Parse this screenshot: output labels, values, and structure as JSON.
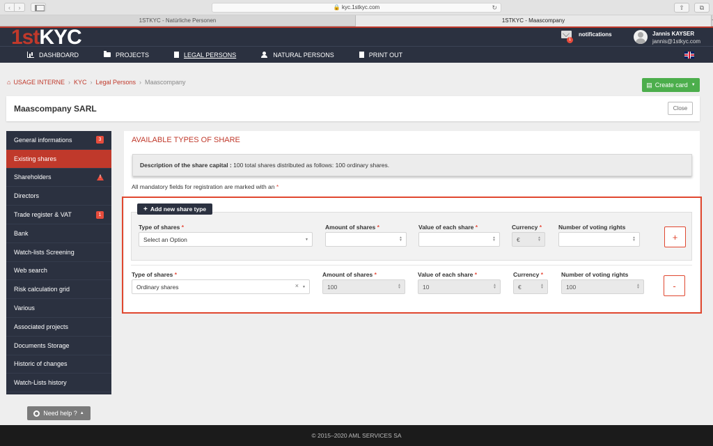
{
  "browser": {
    "url": "kyc.1stkyc.com",
    "tabs": [
      "1STKYC - Natürliche Personen",
      "1STKYC - Maascompany"
    ],
    "new_tab": "+"
  },
  "header": {
    "logo_part1": "1st",
    "logo_part2": "KYC",
    "notifications_label": "notifications",
    "notifications_count": "1",
    "user_name": "Jannis KAYSER",
    "user_email": "jannis@1stkyc.com"
  },
  "nav": {
    "items": [
      "DASHBOARD",
      "PROJECTS",
      "LEGAL PERSONS",
      "NATURAL PERSONS",
      "PRINT OUT"
    ]
  },
  "breadcrumb": {
    "items": [
      "USAGE INTERNE",
      "KYC",
      "Legal Persons",
      "Maascompany"
    ],
    "separator": "›"
  },
  "actions": {
    "create_card": "Create card",
    "close": "Close",
    "help": "Need help ?"
  },
  "page": {
    "title": "Maascompany SARL"
  },
  "sidebar": {
    "items": [
      {
        "label": "General informations",
        "badge": "3"
      },
      {
        "label": "Existing shares"
      },
      {
        "label": "Shareholders"
      },
      {
        "label": "Directors"
      },
      {
        "label": "Trade register & VAT",
        "badge": "1"
      },
      {
        "label": "Bank"
      },
      {
        "label": "Watch-lists Screening"
      },
      {
        "label": "Web search"
      },
      {
        "label": "Risk calculation grid"
      },
      {
        "label": "Various"
      },
      {
        "label": "Associated projects"
      },
      {
        "label": "Documents Storage"
      },
      {
        "label": "Historic of changes"
      },
      {
        "label": "Watch-Lists history"
      }
    ]
  },
  "shares": {
    "section_title": "AVAILABLE TYPES OF SHARE",
    "description_label": "Description of the share capital :",
    "description_text": " 100 total shares distributed as follows: 100 ordinary shares.",
    "mandatory_note": "All mandatory fields for registration are marked with an",
    "asterisk": "*",
    "add_button": "Add new share type",
    "labels": {
      "type": "Type of shares",
      "amount": "Amount of shares",
      "value": "Value of each share",
      "currency": "Currency",
      "voting": "Number of voting rights"
    },
    "new_row": {
      "type_placeholder": "Select an Option",
      "currency": "€",
      "add": "+"
    },
    "existing_row": {
      "type": "Ordinary shares",
      "amount": "100",
      "value": "10",
      "currency": "€",
      "voting": "100",
      "remove": "-"
    }
  },
  "footer": {
    "copyright": "© 2015–2020 AML SERVICES SA"
  }
}
